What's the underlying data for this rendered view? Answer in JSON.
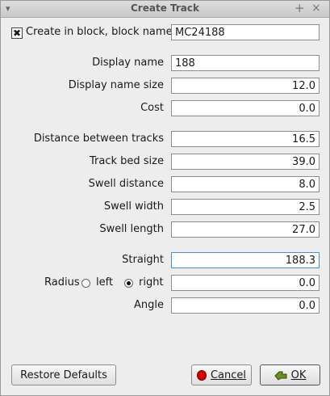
{
  "window": {
    "title": "Create Track"
  },
  "block": {
    "checked": true,
    "label": "Create in block, block name",
    "value": "MC24188"
  },
  "fields": {
    "display_name": {
      "label": "Display name",
      "value": "188"
    },
    "display_name_size": {
      "label": "Display name size",
      "value": "12.0"
    },
    "cost": {
      "label": "Cost",
      "value": "0.0"
    },
    "distance_between_tracks": {
      "label": "Distance between tracks",
      "value": "16.5"
    },
    "track_bed_size": {
      "label": "Track bed size",
      "value": "39.0"
    },
    "swell_distance": {
      "label": "Swell distance",
      "value": "8.0"
    },
    "swell_width": {
      "label": "Swell width",
      "value": "2.5"
    },
    "swell_length": {
      "label": "Swell length",
      "value": "27.0"
    },
    "straight": {
      "label": "Straight",
      "value": "188.3"
    },
    "radius": {
      "label": "Radius",
      "value": "0.0"
    },
    "angle": {
      "label": "Angle",
      "value": "0.0"
    }
  },
  "radius_options": {
    "left": "left",
    "right": "right",
    "selected": "right"
  },
  "buttons": {
    "restore_defaults": "Restore Defaults",
    "cancel": "Cancel",
    "ok": "OK"
  }
}
